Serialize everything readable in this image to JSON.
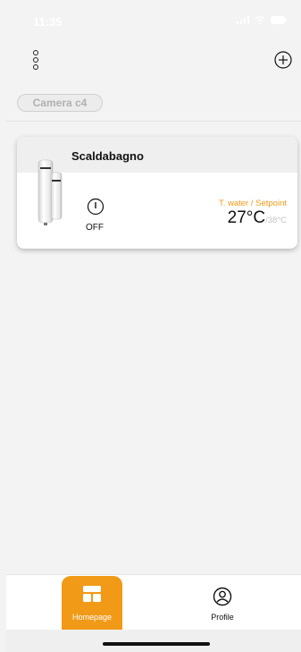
{
  "status_bar": {
    "time": "11:35",
    "icons": [
      "cellular-signal-icon",
      "wifi-icon",
      "battery-icon"
    ]
  },
  "header": {
    "menu_icon": "vertical-dots-icon",
    "add_icon": "plus-circle-icon"
  },
  "room_chip": {
    "label": "Camera c4"
  },
  "device": {
    "name": "Scaldabagno",
    "image": "water-heater-icon",
    "power_icon": "power-icon",
    "power_state": "OFF",
    "temp_label": "T. water / Setpoint",
    "temp_current": "27°C",
    "temp_setpoint": "/38°C"
  },
  "bottom_nav": {
    "items": [
      {
        "label": "Homepage",
        "icon": "homepage-icon",
        "active": true
      },
      {
        "label": "Profile",
        "icon": "profile-icon",
        "active": false
      }
    ]
  },
  "colors": {
    "accent": "#f19a18",
    "background": "#f3f3f3",
    "card": "#ffffff"
  }
}
